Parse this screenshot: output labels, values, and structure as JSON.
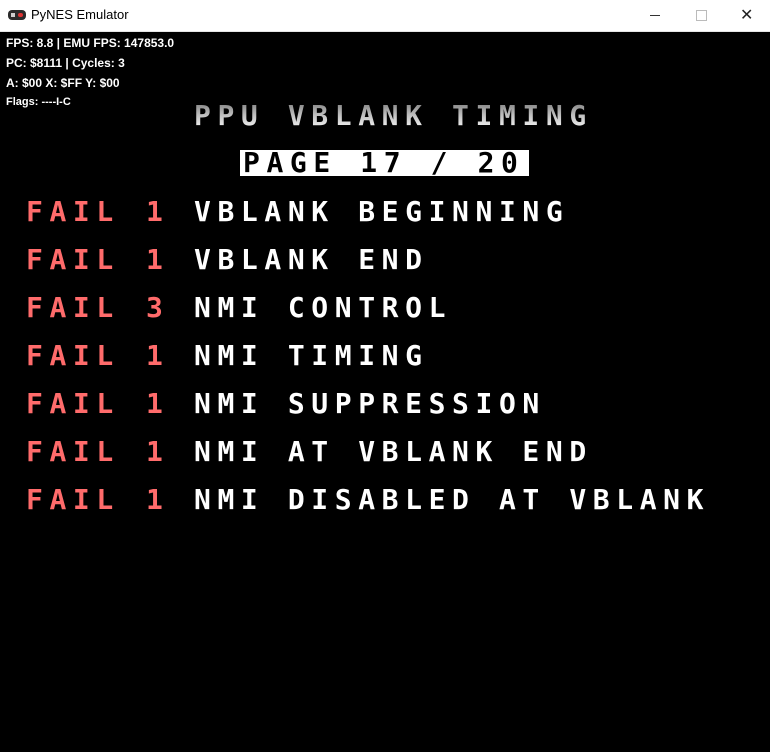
{
  "window": {
    "title": "PyNES Emulator",
    "controls": {
      "minimize": "—",
      "maximize": "☐",
      "close": "✕"
    }
  },
  "debug": {
    "line1": "FPS: 8.8 | EMU FPS: 147853.0",
    "line2": "PC: $8111 | Cycles: 3",
    "line3": "A: $00 X: $FF Y: $00",
    "line4": "Flags: ----I-C"
  },
  "screen": {
    "title": "PPU VBLANK TIMING",
    "page": "PAGE 17 / 20",
    "results": [
      {
        "status": "FAIL",
        "code": "1",
        "name": "VBLANK BEGINNING"
      },
      {
        "status": "FAIL",
        "code": "1",
        "name": "VBLANK END"
      },
      {
        "status": "FAIL",
        "code": "3",
        "name": "NMI CONTROL"
      },
      {
        "status": "FAIL",
        "code": "1",
        "name": "NMI TIMING"
      },
      {
        "status": "FAIL",
        "code": "1",
        "name": "NMI SUPPRESSION"
      },
      {
        "status": "FAIL",
        "code": "1",
        "name": "NMI AT VBLANK END"
      },
      {
        "status": "FAIL",
        "code": "1",
        "name": "NMI DISABLED AT VBLANK"
      }
    ]
  },
  "colors": {
    "background": "#000000",
    "fail": "#ff6b6b",
    "text": "#ffffff",
    "page_box": "#ffffff"
  }
}
